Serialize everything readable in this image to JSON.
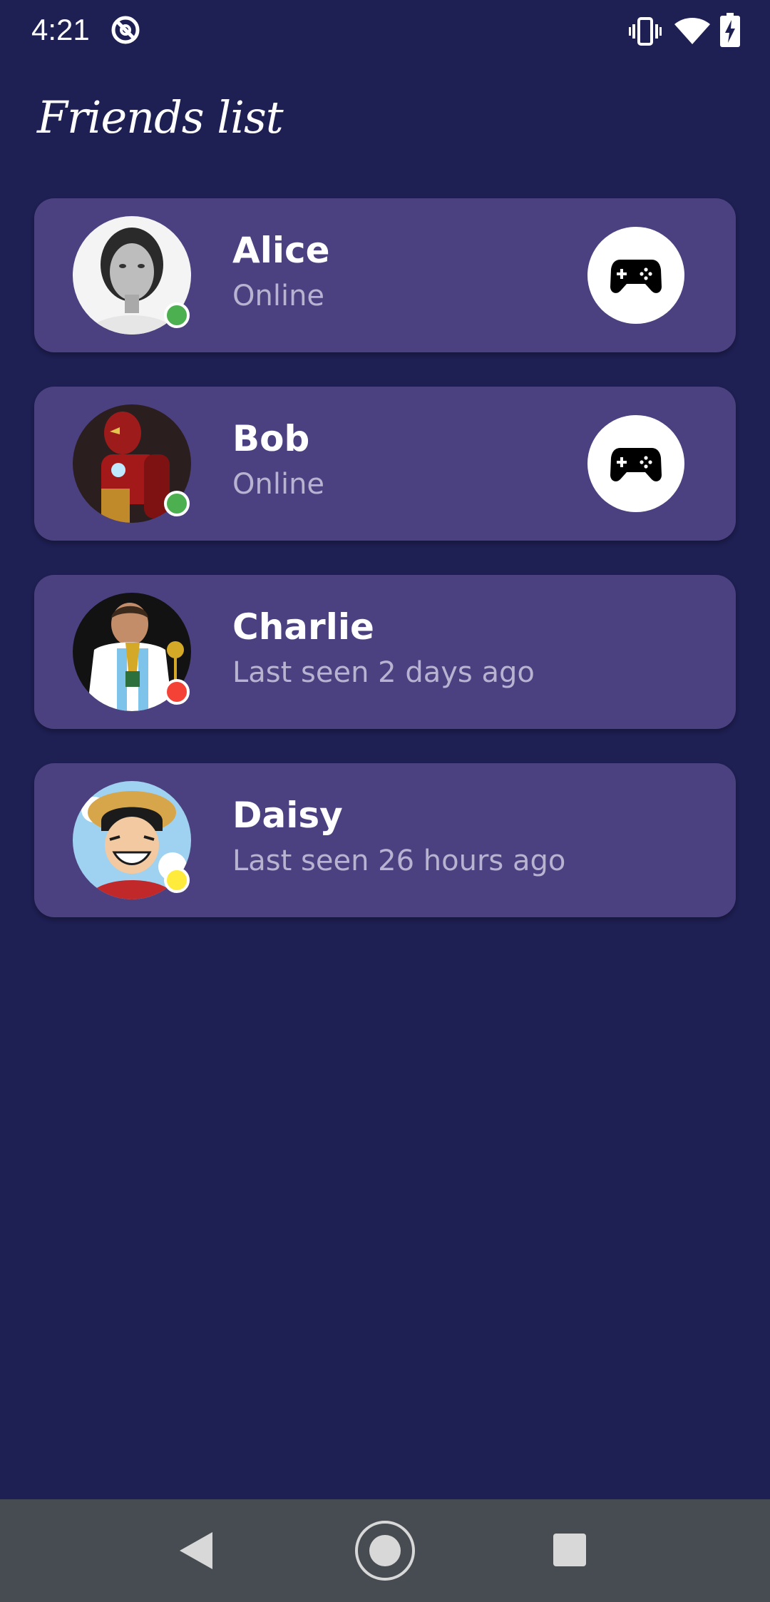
{
  "status_bar": {
    "time": "4:21",
    "icons": [
      "do-not-disturb-icon",
      "vibrate-icon",
      "wifi-icon",
      "battery-charging-icon"
    ]
  },
  "title": "Friends list",
  "friends": [
    {
      "name": "Alice",
      "status": "Online",
      "presence": "online",
      "presence_color": "#4caf50",
      "show_game_button": true,
      "avatar": "woman-portrait-avatar"
    },
    {
      "name": "Bob",
      "status": "Online",
      "presence": "online",
      "presence_color": "#4caf50",
      "show_game_button": true,
      "avatar": "iron-man-avatar"
    },
    {
      "name": "Charlie",
      "status": "Last seen 2 days ago",
      "presence": "offline",
      "presence_color": "#f44336",
      "show_game_button": false,
      "avatar": "footballer-trophy-avatar"
    },
    {
      "name": "Daisy",
      "status": "Last seen 26 hours ago",
      "presence": "away",
      "presence_color": "#ffeb3b",
      "show_game_button": false,
      "avatar": "anime-character-avatar"
    }
  ],
  "colors": {
    "background": "#1e1f52",
    "card": "#4c4180",
    "status_text": "#b9b3d2",
    "nav_bar": "#464c52"
  },
  "nav": {
    "buttons": [
      "back-icon",
      "home-icon",
      "recent-apps-icon"
    ]
  }
}
